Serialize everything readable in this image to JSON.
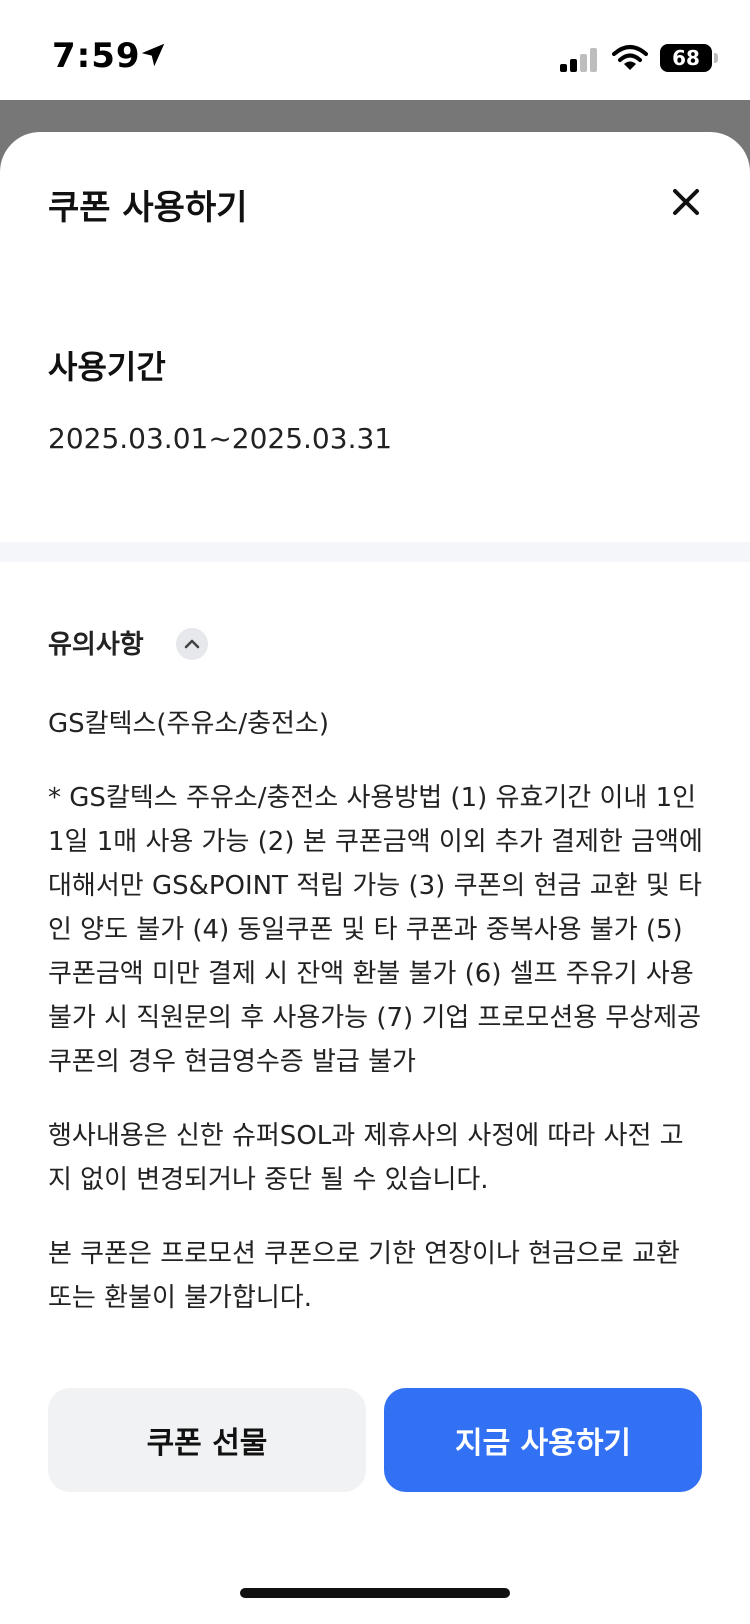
{
  "status_bar": {
    "time": "7:59",
    "battery": "68",
    "icons": [
      "location-arrow-icon",
      "cellular-signal-icon",
      "wifi-icon",
      "battery-icon"
    ]
  },
  "sheet": {
    "title": "쿠폰 사용하기",
    "close_icon": "close-icon"
  },
  "period": {
    "title": "사용기간",
    "value": "2025.03.01~2025.03.31"
  },
  "notice": {
    "title": "유의사항",
    "toggle_icon": "chevron-up-icon",
    "paragraphs": [
      "GS칼텍스(주유소/충전소)",
      "* GS칼텍스 주유소/충전소 사용방법 (1) 유효기간 이내 1인 1일 1매 사용 가능 (2) 본 쿠폰금액 이외 추가 결제한 금액에 대해서만 GS&POINT 적립 가능 (3) 쿠폰의 현금 교환 및 타인 양도 불가 (4) 동일쿠폰 및 타 쿠폰과 중복사용 불가 (5) 쿠폰금액 미만 결제 시 잔액 환불 불가 (6) 셀프 주유기 사용불가 시 직원문의 후 사용가능 (7) 기업 프로모션용 무상제공 쿠폰의 경우 현금영수증 발급 불가",
      "행사내용은 신한 슈퍼SOL과 제휴사의 사정에 따라 사전 고지 없이 변경되거나 중단 될 수 있습니다.",
      "본 쿠폰은 프로모션 쿠폰으로 기한 연장이나 현금으로 교환 또는 환불이 불가합니다."
    ]
  },
  "actions": {
    "gift_label": "쿠폰 선물",
    "use_label": "지금 사용하기"
  },
  "colors": {
    "primary": "#3270f4",
    "secondary_button": "#f1f2f4",
    "divider": "#f4f6fa",
    "overlay": "#777777"
  }
}
